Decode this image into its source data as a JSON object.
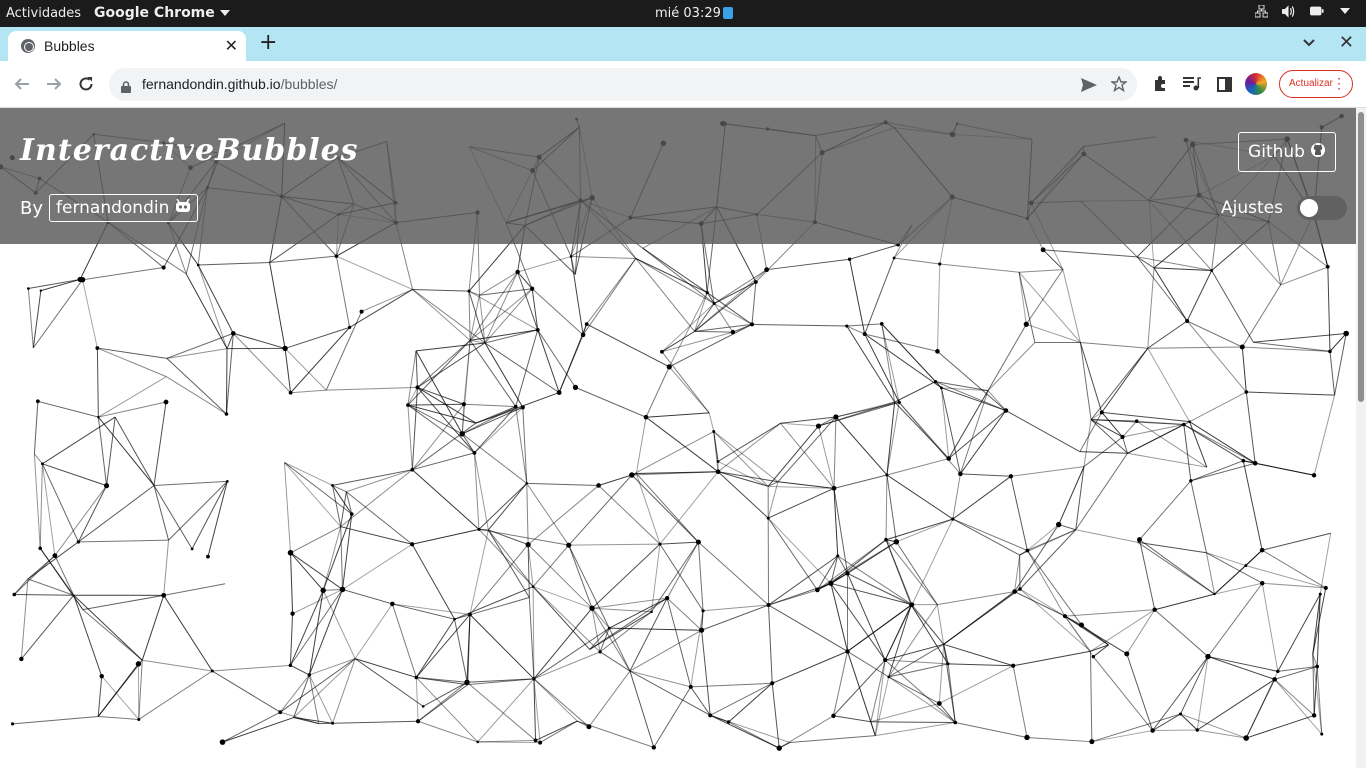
{
  "topbar": {
    "activities": "Actividades",
    "app_menu": "Google Chrome",
    "clock": "mié 03:29",
    "tray_icons": [
      "network-icon",
      "volume-icon",
      "battery-icon",
      "power-menu-icon"
    ]
  },
  "browser": {
    "tab_title": "Bubbles",
    "url_host": "fernandondin.github.io",
    "url_path": "/bubbles/",
    "update_label": "Actualizar"
  },
  "page": {
    "title": "InteractiveBubbles",
    "by_label": "By",
    "author": "fernandondin",
    "github_label": "Github",
    "settings_label": "Ajustes",
    "settings_enabled": false
  },
  "colors": {
    "header_overlay": "#585858",
    "tab_strip": "#b3e5f2",
    "update_red": "#d93025",
    "node": "#000000"
  }
}
